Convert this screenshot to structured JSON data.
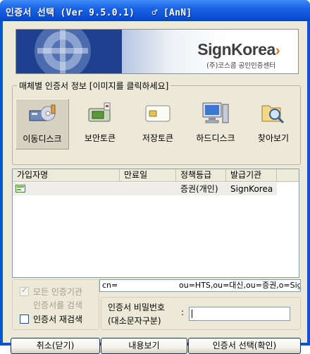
{
  "window": {
    "title": "인증서 선택 (Ver 9.5.0.1)",
    "title_tag": "♂ [AnN]"
  },
  "banner": {
    "brand": "SignKorea",
    "brand_arrow": "›",
    "subtitle": "(주)코스콤 공인인증센터"
  },
  "media_group": {
    "legend": "매체별 인증서 정보 [이미지를 클릭하세요]",
    "items": [
      {
        "label": "이동디스크",
        "icon": "removable-disk-icon",
        "selected": true
      },
      {
        "label": "보안토큰",
        "icon": "security-token-icon",
        "selected": false
      },
      {
        "label": "저장토큰",
        "icon": "storage-token-icon",
        "selected": false
      },
      {
        "label": "하드디스크",
        "icon": "hard-disk-icon",
        "selected": false
      },
      {
        "label": "찾아보기",
        "icon": "browse-icon",
        "selected": false
      }
    ]
  },
  "cert_table": {
    "columns": [
      "가입자명",
      "만료일",
      "정책등급",
      "발급기관"
    ],
    "rows": [
      {
        "subscriber": "",
        "expiry": "",
        "policy": "증권(개인)",
        "issuer": "SignKorea"
      }
    ]
  },
  "search_options": {
    "all_ca_line1": "모든 인증기관",
    "all_ca_line2": "인증서를 검색",
    "all_ca_checked": true,
    "rescan_label": "인증서 재검색",
    "rescan_checked": false
  },
  "dn_field": {
    "cn": "cn=",
    "rest": "ou=HTS,ou=대신,ou=증권,o=Sig"
  },
  "password": {
    "label_line1": "인증서 비밀번호",
    "label_line2": "(대소문자구분)",
    "separator": ":",
    "value": ""
  },
  "buttons": {
    "cancel": "취소(닫기)",
    "view": "내용보기",
    "select": "인증서 선택(확인)"
  },
  "colors": {
    "titlebar": "#0a54d4",
    "dialog_bg": "#ece9d8",
    "brand_accent": "#e46a1c"
  }
}
